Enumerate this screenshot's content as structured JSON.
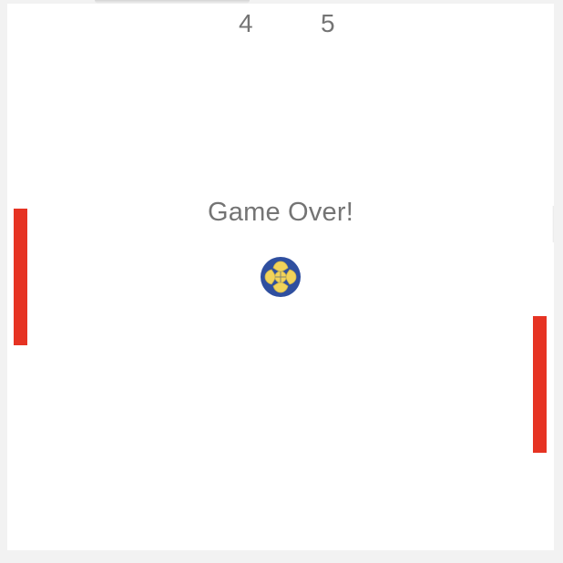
{
  "scoreboard": {
    "left_score": "4",
    "right_score": "5"
  },
  "status": {
    "message": "Game Over!"
  },
  "paddles": {
    "color": "#e63323"
  },
  "ball": {
    "icon": "soccer-ball-icon",
    "colors": {
      "outer": "#2f4f9f",
      "inner": "#f2d35a"
    }
  }
}
